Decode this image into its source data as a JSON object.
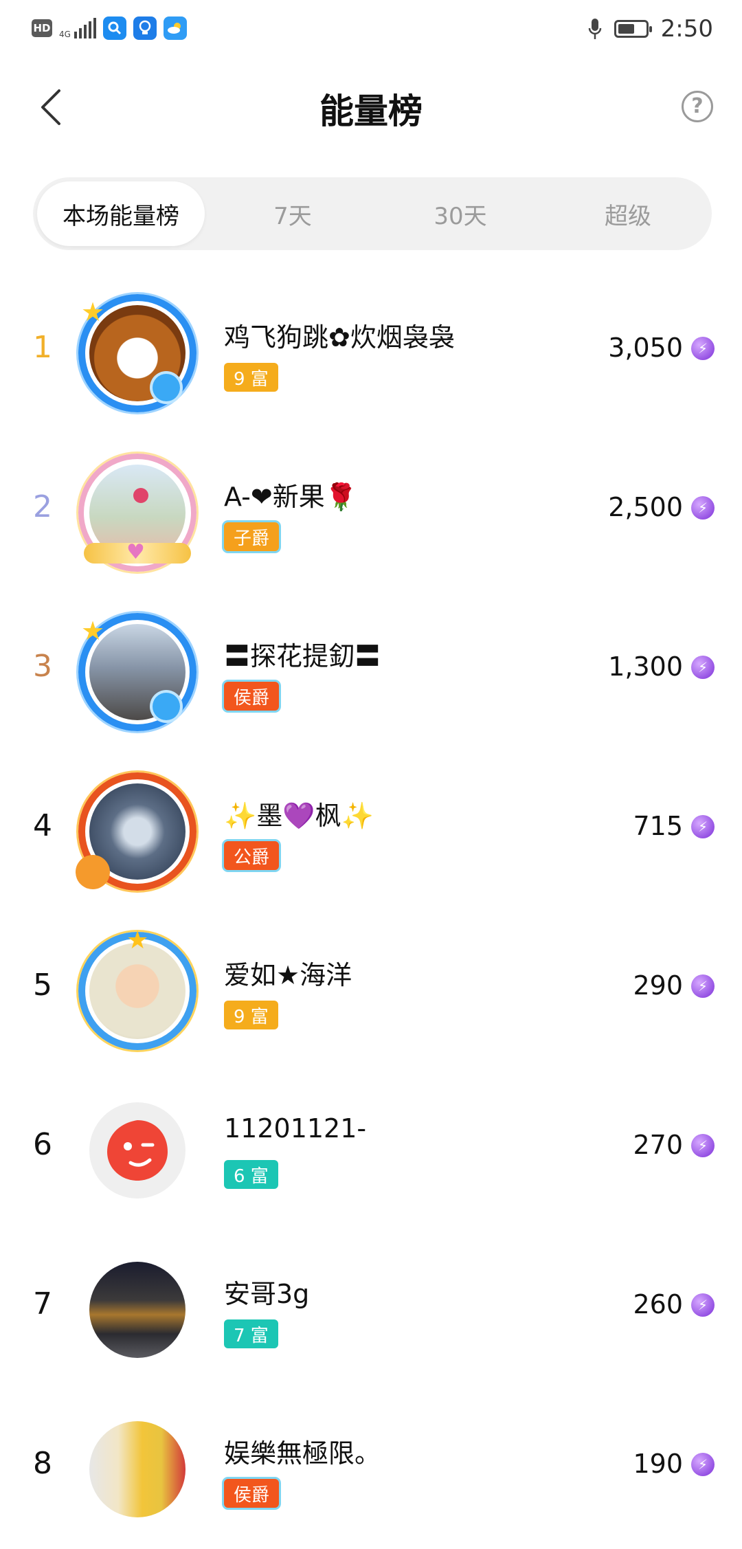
{
  "status_bar": {
    "hd": "HD",
    "network": "4G",
    "time": "2:50",
    "battery_level": 0.6
  },
  "header": {
    "title": "能量榜",
    "help": "?"
  },
  "tabs": [
    {
      "label": "本场能量榜",
      "active": true
    },
    {
      "label": "7天",
      "active": false
    },
    {
      "label": "30天",
      "active": false
    },
    {
      "label": "超级",
      "active": false
    }
  ],
  "accent": {
    "gold": "#f1b02a",
    "silver": "#9aa0e0",
    "bronze": "#c8834d",
    "badge_fu_gold": "#f5ac1c",
    "badge_fu_teal": "#1cc6b4",
    "badge_noble": "#f2561d"
  },
  "entries": [
    {
      "rank": "1",
      "name": "鸡飞狗跳✿炊烟袅袅",
      "badge": "9 富",
      "score": "3,050"
    },
    {
      "rank": "2",
      "name": "A-❤新果🌹",
      "badge": "子爵",
      "score": "2,500"
    },
    {
      "rank": "3",
      "name": "〓探花提釖〓",
      "badge": "侯爵",
      "score": "1,300"
    },
    {
      "rank": "4",
      "name": "✨墨💜枫✨",
      "badge": "公爵",
      "score": "715"
    },
    {
      "rank": "5",
      "name": "爱如★海洋",
      "badge": "9 富",
      "score": "290"
    },
    {
      "rank": "6",
      "name": "11201121-",
      "badge": "6 富",
      "score": "270"
    },
    {
      "rank": "7",
      "name": "安哥3g",
      "badge": "7 富",
      "score": "260"
    },
    {
      "rank": "8",
      "name": "娱樂無極限。",
      "badge": "侯爵",
      "score": "190"
    }
  ]
}
